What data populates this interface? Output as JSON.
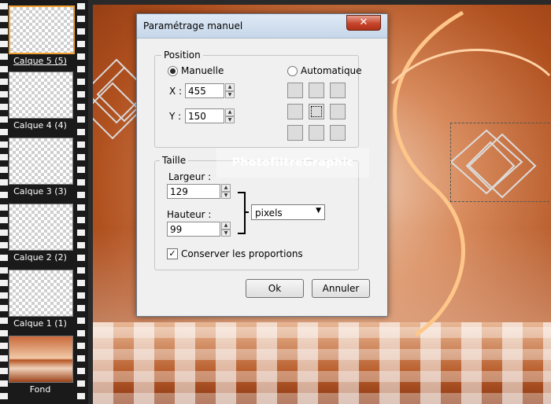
{
  "layers": [
    {
      "label": "Calque 5 (5)",
      "active": true
    },
    {
      "label": "Calque 4 (4)",
      "active": false
    },
    {
      "label": "Calque 3 (3)",
      "active": false
    },
    {
      "label": "Calque 2 (2)",
      "active": false
    },
    {
      "label": "Calque 1 (1)",
      "active": false
    },
    {
      "label": "Fond",
      "active": false
    }
  ],
  "watermark": "PhotofiltreGraphic",
  "dialog": {
    "title": "Paramétrage manuel",
    "close_label": "✕",
    "position": {
      "legend": "Position",
      "manual_label": "Manuelle",
      "auto_label": "Automatique",
      "x_label": "X :",
      "x_value": "455",
      "y_label": "Y :",
      "y_value": "150"
    },
    "taille": {
      "legend": "Taille",
      "width_label": "Largeur :",
      "width_value": "129",
      "height_label": "Hauteur :",
      "height_value": "99",
      "unit_selected": "pixels"
    },
    "keep_proportions_label": "Conserver les proportions",
    "keep_proportions_checked": true,
    "ok_label": "Ok",
    "cancel_label": "Annuler"
  }
}
